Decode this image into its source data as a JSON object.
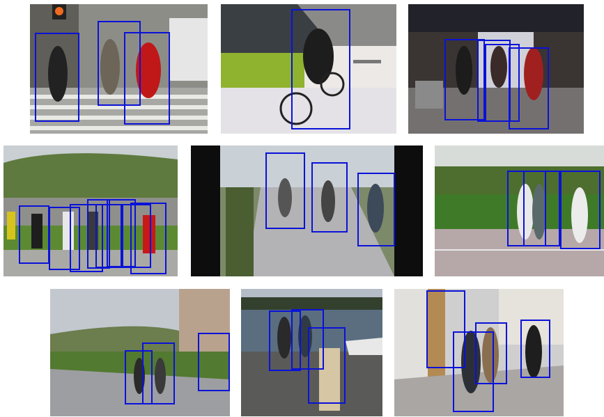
{
  "figure": {
    "panel_count": 9,
    "box_color": "#0a12d8",
    "panels": [
      {
        "scene": "crosswalk",
        "box_count": 3
      },
      {
        "scene": "snow-cyclist",
        "box_count": 1
      },
      {
        "scene": "mall-entrance",
        "box_count": 4
      },
      {
        "scene": "park-crowd",
        "box_count": 8
      },
      {
        "scene": "path-walkers",
        "box_count": 3
      },
      {
        "scene": "garden-walkers",
        "box_count": 3
      },
      {
        "scene": "campus-road",
        "box_count": 3
      },
      {
        "scene": "harbor",
        "box_count": 3
      },
      {
        "scene": "town-street",
        "box_count": 4
      }
    ]
  }
}
